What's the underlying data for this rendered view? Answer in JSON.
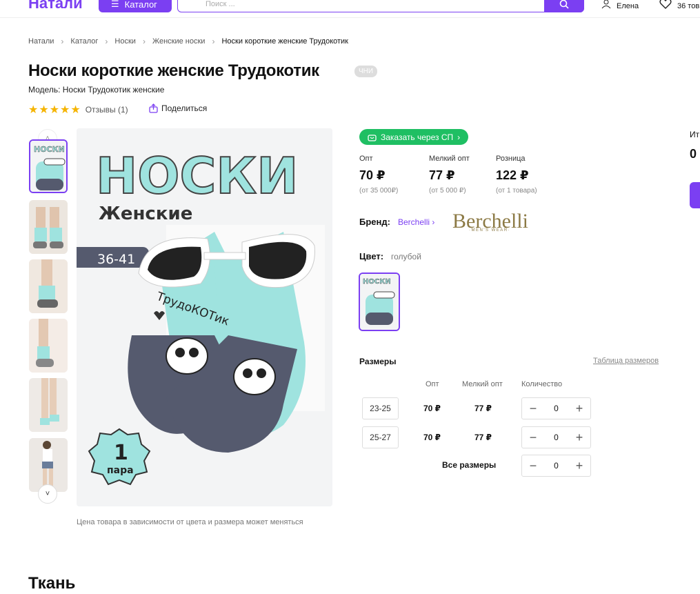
{
  "header": {
    "logo": "Натали",
    "catalog_label": "Каталог",
    "search_placeholder": "Поиск ...",
    "user_name": "Елена",
    "favorites_count": "36 тов"
  },
  "breadcrumbs": [
    "Натали",
    "Каталог",
    "Носки",
    "Женские носки",
    "Носки короткие женские Трудокотик"
  ],
  "product": {
    "title": "Носки короткие женские Трудокотик",
    "badge": "ЧНИ",
    "model": "Модель: Носки Трудокотик женские",
    "rating": 5,
    "reviews": "Отзывы (1)",
    "share": "Поделиться",
    "price_note": "Цена товара в зависимости от цвета и размера может меняться",
    "image_text": {
      "headline": "НОСКИ",
      "sub": "Женские",
      "size": "36-41",
      "sock_print": "ТрудоКОТик",
      "pack_count": "1",
      "pack_word": "пара"
    }
  },
  "order": {
    "sp_button": "Заказать через СП",
    "prices": [
      {
        "label": "Опт",
        "value": "70 ₽",
        "cond": "(от 35 000₽)"
      },
      {
        "label": "Мелкий опт",
        "value": "77 ₽",
        "cond": "(от 5 000 ₽)"
      },
      {
        "label": "Розница",
        "value": "122 ₽",
        "cond": "(от 1 товара)"
      }
    ],
    "brand_label": "Бренд:",
    "brand_name": "Berchelli",
    "brand_logo": "Berchelli",
    "brand_logo_sub": "·MEN'S WEAR·",
    "color_label": "Цвет:",
    "color_value": "голубой",
    "sizes_title": "Размеры",
    "size_table_link": "Таблица размеров",
    "columns": [
      "Опт",
      "Мелкий опт",
      "Количество"
    ],
    "sizes": [
      {
        "size": "23-25",
        "opt": "70 ₽",
        "small": "77 ₽",
        "qty": "0"
      },
      {
        "size": "25-27",
        "opt": "70 ₽",
        "small": "77 ₽",
        "qty": "0"
      }
    ],
    "all_sizes_label": "Все размеры",
    "all_sizes_qty": "0"
  },
  "edge": {
    "label": "Ит",
    "value": "0"
  },
  "fabric_title": "Ткань",
  "colors": {
    "accent": "#7b3ff2",
    "green": "#1fbf63",
    "star": "#f5b400",
    "mint": "#9fe3df",
    "sock_dark": "#555a6e"
  }
}
